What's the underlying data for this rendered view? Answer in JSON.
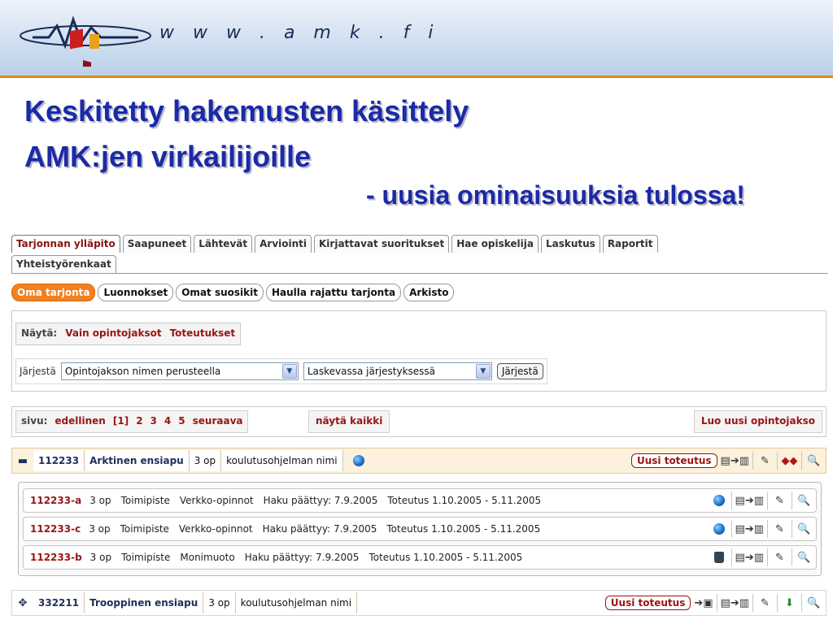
{
  "header": {
    "site_url": "w w w . a m k . f i"
  },
  "slide": {
    "title_line1": "Keskitetty hakemusten käsittely",
    "title_line2": "AMK:jen virkailijoille",
    "subtitle": "- uusia ominaisuuksia tulossa!"
  },
  "tabs": [
    "Tarjonnan ylläpito",
    "Saapuneet",
    "Lähtevät",
    "Arviointi",
    "Kirjattavat suoritukset",
    "Hae opiskelija",
    "Laskutus",
    "Raportit",
    "Yhteistyörenkaat"
  ],
  "subtabs": [
    "Oma tarjonta",
    "Luonnokset",
    "Omat suosikit",
    "Haulla rajattu tarjonta",
    "Arkisto"
  ],
  "filters": {
    "show_label": "Näytä:",
    "show_courses": "Vain opintojaksot",
    "show_realizations": "Toteutukset",
    "sort_label": "Järjestä",
    "sort_field": "Opintojakson nimen perusteella",
    "sort_order": "Laskevassa järjestyksessä",
    "sort_button": "Järjestä"
  },
  "pager": {
    "label": "sivu:",
    "prev": "edellinen",
    "pages": [
      "[1]",
      "2",
      "3",
      "4",
      "5"
    ],
    "next": "seuraava",
    "show_all": "näytä kaikki",
    "create_course": "Luo uusi opintojakso"
  },
  "courses": [
    {
      "toggle": "▬",
      "code": "112233",
      "name": "Arktinen ensiapu",
      "credits": "3 op",
      "program": "koulutusohjelman nimi",
      "new_realization": "Uusi toteutus",
      "realizations": [
        {
          "code": "112233-a",
          "credits": "3 op",
          "unit": "Toimipiste",
          "mode": "Verkko-opinnot",
          "application": "Haku päättyy: 7.9.2005",
          "period": "Toteutus 1.10.2005 - 5.11.2005"
        },
        {
          "code": "112233-c",
          "credits": "3 op",
          "unit": "Toimipiste",
          "mode": "Verkko-opinnot",
          "application": "Haku päättyy: 7.9.2005",
          "period": "Toteutus 1.10.2005 - 5.11.2005"
        },
        {
          "code": "112233-b",
          "credits": "3 op",
          "unit": "Toimipiste",
          "mode": "Monimuoto",
          "application": "Haku päättyy: 7.9.2005",
          "period": "Toteutus 1.10.2005 - 5.11.2005"
        }
      ]
    },
    {
      "toggle": "✥",
      "code": "332211",
      "name": "Trooppinen ensiapu",
      "credits": "3 op",
      "program": "koulutusohjelman nimi",
      "new_realization": "Uusi toteutus"
    }
  ],
  "icons": {
    "transfer": "▤➔▥",
    "edit": "✎",
    "inspect": "🔍",
    "delete": "🗑"
  },
  "colors": {
    "title_blue": "#1b2aa6",
    "link_red": "#9a1414",
    "active_subtab_orange": "#f28020",
    "header_stripe": "#d98b1a"
  }
}
